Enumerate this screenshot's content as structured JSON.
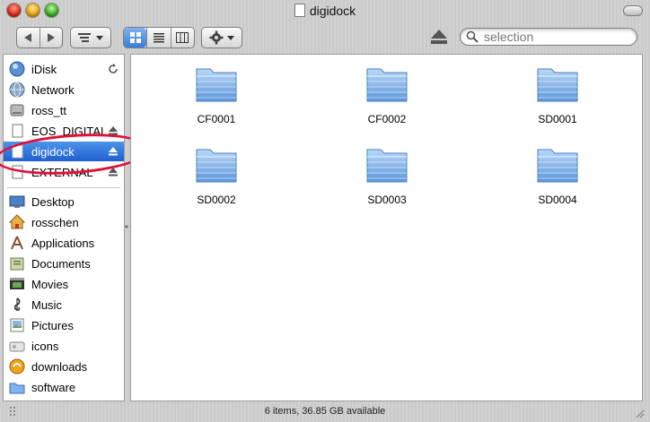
{
  "window": {
    "title": "digidock"
  },
  "toolbar": {
    "back_icon": "back-arrow-icon",
    "forward_icon": "forward-arrow-icon",
    "views": [
      "icon-view",
      "list-view",
      "column-view"
    ],
    "active_view": "icon-view"
  },
  "search": {
    "placeholder": "selection"
  },
  "sidebar": {
    "devices": [
      {
        "label": "iDisk",
        "icon": "idisk-icon",
        "action_icon": "sync-icon"
      },
      {
        "label": "Network",
        "icon": "network-globe-icon"
      },
      {
        "label": "ross_tt",
        "icon": "hard-drive-icon"
      },
      {
        "label": "EOS_DIGITAL",
        "icon": "removable-disk-icon",
        "action_icon": "eject-icon"
      },
      {
        "label": "digidock",
        "icon": "removable-disk-icon",
        "action_icon": "eject-icon",
        "selected": true
      },
      {
        "label": "EXTERNAL",
        "icon": "removable-disk-icon",
        "action_icon": "eject-icon"
      }
    ],
    "places": [
      {
        "label": "Desktop",
        "icon": "desktop-icon"
      },
      {
        "label": "rosschen",
        "icon": "home-icon"
      },
      {
        "label": "Applications",
        "icon": "applications-icon"
      },
      {
        "label": "Documents",
        "icon": "documents-icon"
      },
      {
        "label": "Movies",
        "icon": "movies-icon"
      },
      {
        "label": "Music",
        "icon": "music-icon"
      },
      {
        "label": "Pictures",
        "icon": "pictures-icon"
      },
      {
        "label": "icons",
        "icon": "folder-icon"
      },
      {
        "label": "downloads",
        "icon": "downloads-icon"
      },
      {
        "label": "software",
        "icon": "folder-icon"
      }
    ]
  },
  "content": {
    "folders": [
      "CF0001",
      "CF0002",
      "SD0001",
      "SD0002",
      "SD0003",
      "SD0004"
    ]
  },
  "status": {
    "text": "6 items, 36.85 GB available"
  },
  "colors": {
    "selection": "#2f74dc",
    "annotation": "#e0103a",
    "folder": "#7fb3ea"
  }
}
